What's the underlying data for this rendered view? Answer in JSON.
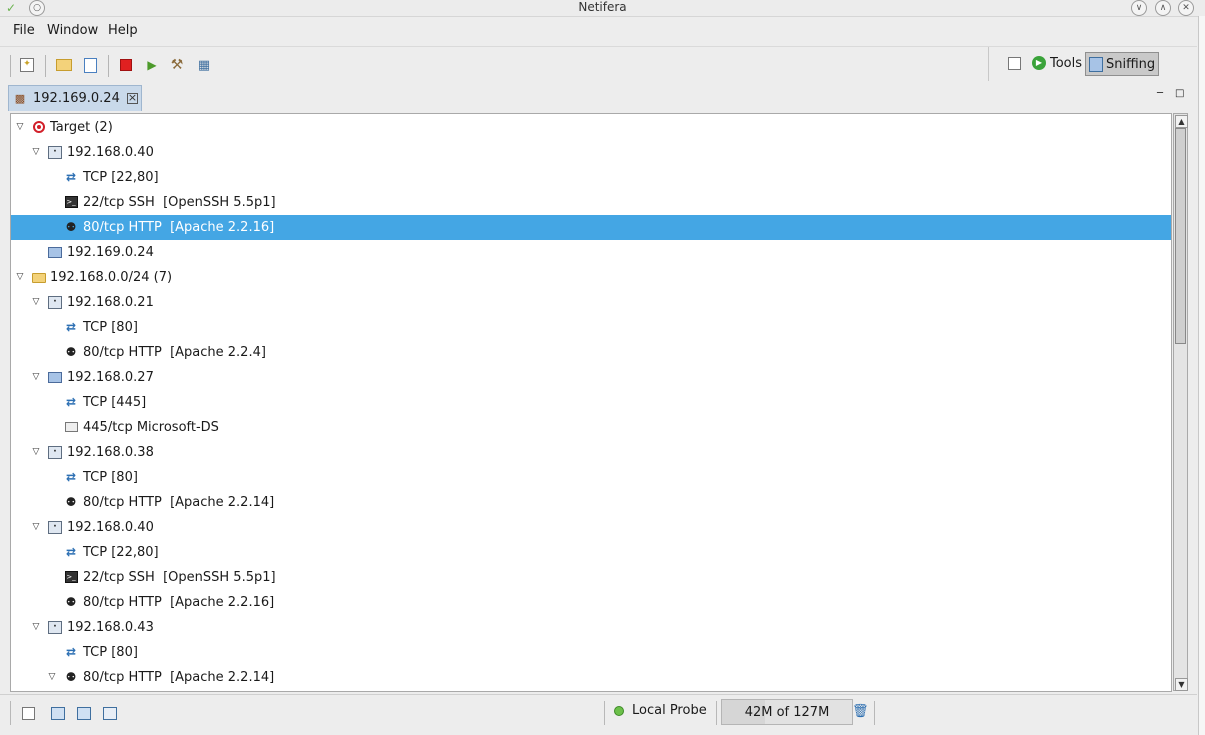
{
  "window": {
    "title": "Netifera"
  },
  "menu": {
    "items": [
      "File",
      "Window",
      "Help"
    ]
  },
  "toolbar": {
    "buttons": [
      "new-workspace-icon",
      "open-folder-icon",
      "open-file-icon",
      "stop-icon",
      "play-icon",
      "tools-icon",
      "network-icon"
    ]
  },
  "perspectives": {
    "tools_label": "Tools",
    "sniffing_label": "Sniffing"
  },
  "tab": {
    "label": "192.169.0.24"
  },
  "tree": {
    "rows": [
      {
        "label": "Target (2)",
        "depth": 0,
        "expanded": true,
        "icon": "target"
      },
      {
        "label": "192.168.0.40",
        "depth": 1,
        "expanded": true,
        "icon": "host"
      },
      {
        "label": "TCP [22,80]",
        "depth": 2,
        "icon": "tcp"
      },
      {
        "label": "22/tcp SSH  [OpenSSH 5.5p1]",
        "depth": 2,
        "icon": "terminal"
      },
      {
        "label": "80/tcp HTTP  [Apache 2.2.16]",
        "depth": 2,
        "icon": "tux",
        "selected": true
      },
      {
        "label": "192.169.0.24",
        "depth": 1,
        "icon": "monitor"
      },
      {
        "label": "192.168.0.0/24 (7)",
        "depth": 0,
        "expanded": true,
        "icon": "folder"
      },
      {
        "label": "192.168.0.21",
        "depth": 1,
        "expanded": true,
        "icon": "host"
      },
      {
        "label": "TCP [80]",
        "depth": 2,
        "icon": "tcp"
      },
      {
        "label": "80/tcp HTTP  [Apache 2.2.4]",
        "depth": 2,
        "icon": "tux"
      },
      {
        "label": "192.168.0.27",
        "depth": 1,
        "expanded": true,
        "icon": "monitor"
      },
      {
        "label": "TCP [445]",
        "depth": 2,
        "icon": "tcp"
      },
      {
        "label": "445/tcp Microsoft-DS",
        "depth": 2,
        "icon": "screen"
      },
      {
        "label": "192.168.0.38",
        "depth": 1,
        "expanded": true,
        "icon": "host"
      },
      {
        "label": "TCP [80]",
        "depth": 2,
        "icon": "tcp"
      },
      {
        "label": "80/tcp HTTP  [Apache 2.2.14]",
        "depth": 2,
        "icon": "tux"
      },
      {
        "label": "192.168.0.40",
        "depth": 1,
        "expanded": true,
        "icon": "host"
      },
      {
        "label": "TCP [22,80]",
        "depth": 2,
        "icon": "tcp"
      },
      {
        "label": "22/tcp SSH  [OpenSSH 5.5p1]",
        "depth": 2,
        "icon": "terminal"
      },
      {
        "label": "80/tcp HTTP  [Apache 2.2.16]",
        "depth": 2,
        "icon": "tux"
      },
      {
        "label": "192.168.0.43",
        "depth": 1,
        "expanded": true,
        "icon": "host"
      },
      {
        "label": "TCP [80]",
        "depth": 2,
        "icon": "tcp"
      },
      {
        "label": "80/tcp HTTP  [Apache 2.2.14]",
        "depth": 2,
        "expanded": true,
        "icon": "tux"
      }
    ]
  },
  "status": {
    "probe_label": "Local Probe",
    "heap_label": "42M of 127M",
    "heap_used_fraction": 0.33
  },
  "colors": {
    "selection": "#44a6e4",
    "tab": "#c9d9ea",
    "probe_status": "#6cc04a"
  }
}
